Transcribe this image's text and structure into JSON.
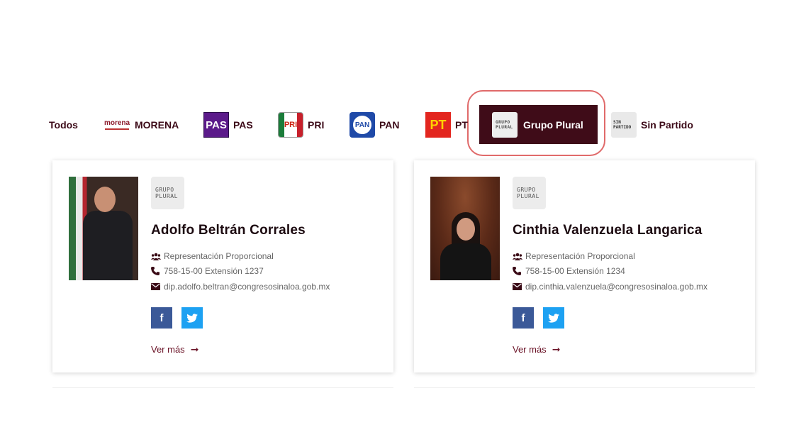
{
  "filters": {
    "todos": "Todos",
    "morena": {
      "label": "MORENA",
      "logo_text": "morena"
    },
    "pas": {
      "label": "PAS",
      "logo_text": "PAS"
    },
    "pri": {
      "label": "PRI",
      "logo_text": "PRI"
    },
    "pan": {
      "label": "PAN",
      "logo_text": "PAN"
    },
    "pt": {
      "label": "PT",
      "logo_text": "PT"
    },
    "grupo_plural": {
      "label": "Grupo Plural",
      "logo_line1": "GRUPO",
      "logo_line2": "PLURAL",
      "active": true
    },
    "sin_partido": {
      "label": "Sin Partido",
      "logo_line1": "SIN",
      "logo_line2": "PARTIDO"
    }
  },
  "colors": {
    "active_tab_bg": "#3f0c18",
    "brand": "#6a1226",
    "highlight_ring": "#e06a6a"
  },
  "cards": [
    {
      "party_line1": "GRUPO",
      "party_line2": "PLURAL",
      "name": "Adolfo Beltrán Corrales",
      "representation": "Representación Proporcional",
      "phone": "758-15-00 Extensión 1237",
      "email": "dip.adolfo.beltran@congresosinaloa.gob.mx",
      "more": "Ver más"
    },
    {
      "party_line1": "GRUPO",
      "party_line2": "PLURAL",
      "name": "Cinthia Valenzuela Langarica",
      "representation": "Representación Proporcional",
      "phone": "758-15-00 Extensión 1234",
      "email": "dip.cinthia.valenzuela@congresosinaloa.gob.mx",
      "more": "Ver más"
    }
  ],
  "icons": {
    "group": "users-icon",
    "phone": "phone-icon",
    "email": "envelope-icon",
    "facebook": "facebook-icon",
    "twitter": "twitter-icon",
    "arrow": "arrow-right-icon"
  }
}
